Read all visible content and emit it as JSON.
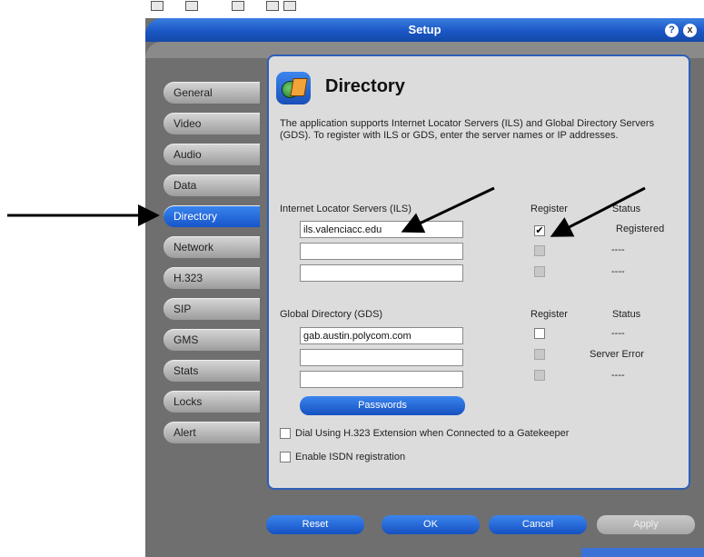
{
  "window": {
    "title": "Setup",
    "help_icon": "?",
    "close_icon": "x"
  },
  "sidebar": {
    "items": [
      {
        "label": "General"
      },
      {
        "label": "Video"
      },
      {
        "label": "Audio"
      },
      {
        "label": "Data"
      },
      {
        "label": "Directory",
        "active": true
      },
      {
        "label": "Network"
      },
      {
        "label": "H.323"
      },
      {
        "label": "SIP"
      },
      {
        "label": "GMS"
      },
      {
        "label": "Stats"
      },
      {
        "label": "Locks"
      },
      {
        "label": "Alert"
      }
    ]
  },
  "panel": {
    "heading": "Directory",
    "icon": "directory-globe-book-icon",
    "description": "The application supports Internet Locator Servers (ILS) and Global Directory Servers (GDS). To register with ILS or GDS, enter the server names or IP addresses.",
    "ils": {
      "label": "Internet Locator Servers (ILS)",
      "register_header": "Register",
      "status_header": "Status",
      "rows": [
        {
          "server": "ils.valenciacc.edu",
          "register": true,
          "register_enabled": true,
          "status": "Registered"
        },
        {
          "server": "",
          "register": false,
          "register_enabled": false,
          "status": "----"
        },
        {
          "server": "",
          "register": false,
          "register_enabled": false,
          "status": "----"
        }
      ]
    },
    "gds": {
      "label": "Global Directory (GDS)",
      "register_header": "Register",
      "status_header": "Status",
      "rows": [
        {
          "server": "gab.austin.polycom.com",
          "register": false,
          "register_enabled": true,
          "status": "----"
        },
        {
          "server": "",
          "register": false,
          "register_enabled": false,
          "status": "Server Error"
        },
        {
          "server": "",
          "register": false,
          "register_enabled": false,
          "status": "----"
        }
      ]
    },
    "passwords_button": "Passwords",
    "options": [
      {
        "label": "Dial Using H.323 Extension when Connected to a Gatekeeper",
        "checked": false
      },
      {
        "label": "Enable ISDN registration",
        "checked": false
      }
    ]
  },
  "footer": {
    "reset": "Reset",
    "ok": "OK",
    "cancel": "Cancel",
    "apply": "Apply",
    "apply_enabled": false
  },
  "colors": {
    "accent": "#1a56c4",
    "panel_bg": "#dcdcdc",
    "frame_bg": "#6f6f6f"
  }
}
